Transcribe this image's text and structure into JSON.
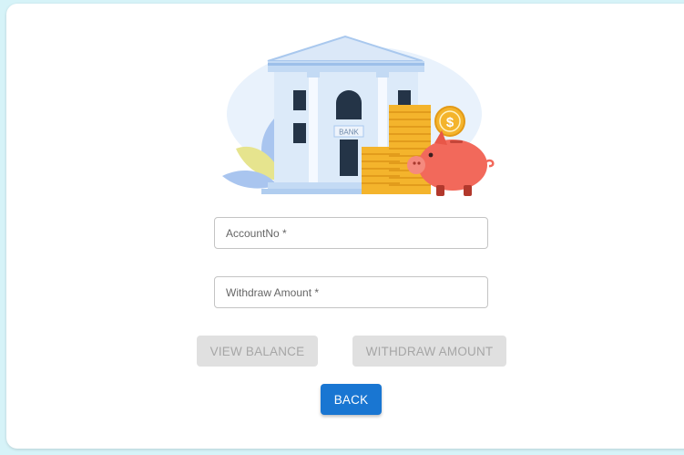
{
  "form": {
    "account_placeholder": "AccountNo *",
    "withdraw_placeholder": "Withdraw Amount *"
  },
  "buttons": {
    "view_balance": "VIEW BALANCE",
    "withdraw_amount": "WITHDRAW AMOUNT",
    "back": "BACK"
  },
  "illustration": {
    "bank_sign": "BANK",
    "coin_symbol": "$"
  },
  "colors": {
    "primary": "#1976d2",
    "page_background": "#d6f3f8",
    "disabled_button": "#e0e0e0"
  }
}
